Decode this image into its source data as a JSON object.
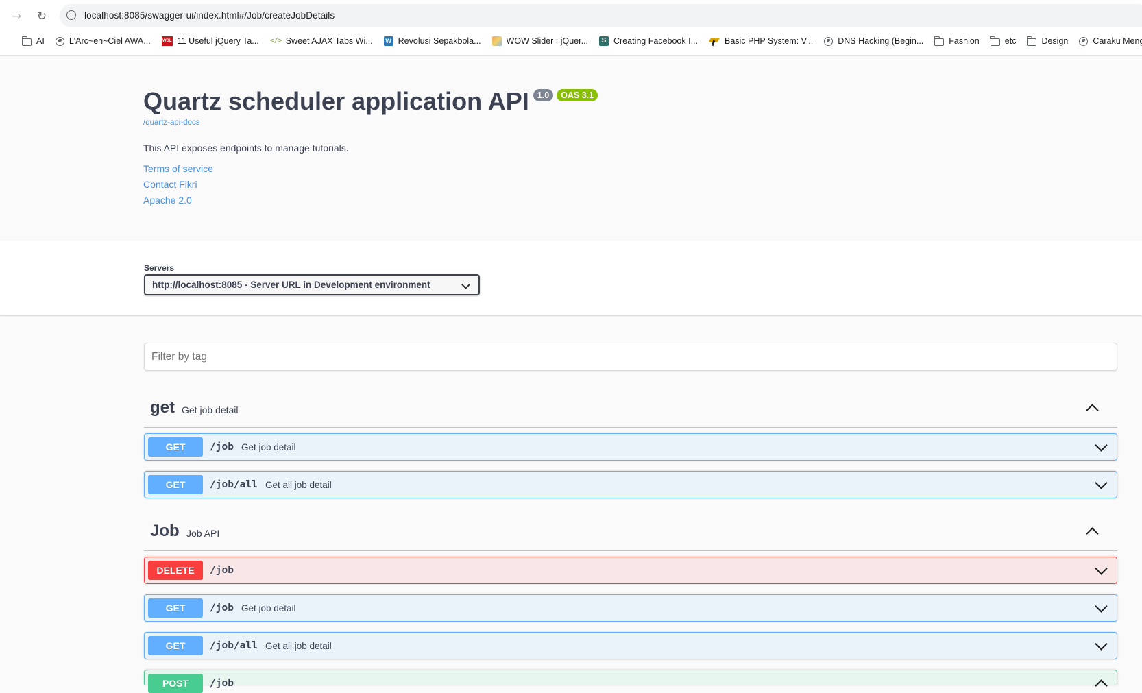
{
  "browser": {
    "url": "localhost:8085/swagger-ui/index.html#/Job/createJobDetails",
    "bookmarks": [
      {
        "label": "AI",
        "icon": "folder-icon"
      },
      {
        "label": "L'Arc~en~Ciel AWA...",
        "icon": "globe-icon"
      },
      {
        "label": "11 Useful jQuery Ta...",
        "icon": "site-icon"
      },
      {
        "label": "Sweet AJAX Tabs Wi...",
        "icon": "code-icon"
      },
      {
        "label": "Revolusi Sepakbola...",
        "icon": "wordpress-icon"
      },
      {
        "label": "WOW Slider : jQuer...",
        "icon": "site-icon"
      },
      {
        "label": "Creating Facebook I...",
        "icon": "site-icon"
      },
      {
        "label": "Basic PHP System: V...",
        "icon": "site-icon"
      },
      {
        "label": "DNS Hacking (Begin...",
        "icon": "globe-icon"
      },
      {
        "label": "Fashion",
        "icon": "folder-icon"
      },
      {
        "label": "etc",
        "icon": "folder-icon"
      },
      {
        "label": "Design",
        "icon": "folder-icon"
      },
      {
        "label": "Caraku Menghasilkan",
        "icon": "globe-icon"
      }
    ]
  },
  "info": {
    "title": "Quartz scheduler application API",
    "version": "1.0",
    "oas": "OAS 3.1",
    "docs_link": "/quartz-api-docs",
    "description": "This API exposes endpoints to manage tutorials.",
    "terms": "Terms of service",
    "contact": "Contact Fikri",
    "license": "Apache 2.0"
  },
  "servers": {
    "label": "Servers",
    "selected": "http://localhost:8085 - Server URL in Development environment"
  },
  "filter": {
    "placeholder": "Filter by tag"
  },
  "tags": [
    {
      "name": "get",
      "description": "Get job detail",
      "operations": [
        {
          "method": "GET",
          "path": "/job",
          "summary": "Get job detail"
        },
        {
          "method": "GET",
          "path": "/job/all",
          "summary": "Get all job detail"
        }
      ]
    },
    {
      "name": "Job",
      "description": "Job API",
      "operations": [
        {
          "method": "DELETE",
          "path": "/job",
          "summary": ""
        },
        {
          "method": "GET",
          "path": "/job",
          "summary": "Get job detail"
        },
        {
          "method": "GET",
          "path": "/job/all",
          "summary": "Get all job detail"
        },
        {
          "method": "POST",
          "path": "/job",
          "summary": ""
        }
      ]
    }
  ],
  "colors": {
    "get": "#61affe",
    "delete": "#f93e3e",
    "post": "#49cc90",
    "link": "#4990e2",
    "oas_badge": "#89bf04",
    "version_badge": "#7d8492"
  }
}
